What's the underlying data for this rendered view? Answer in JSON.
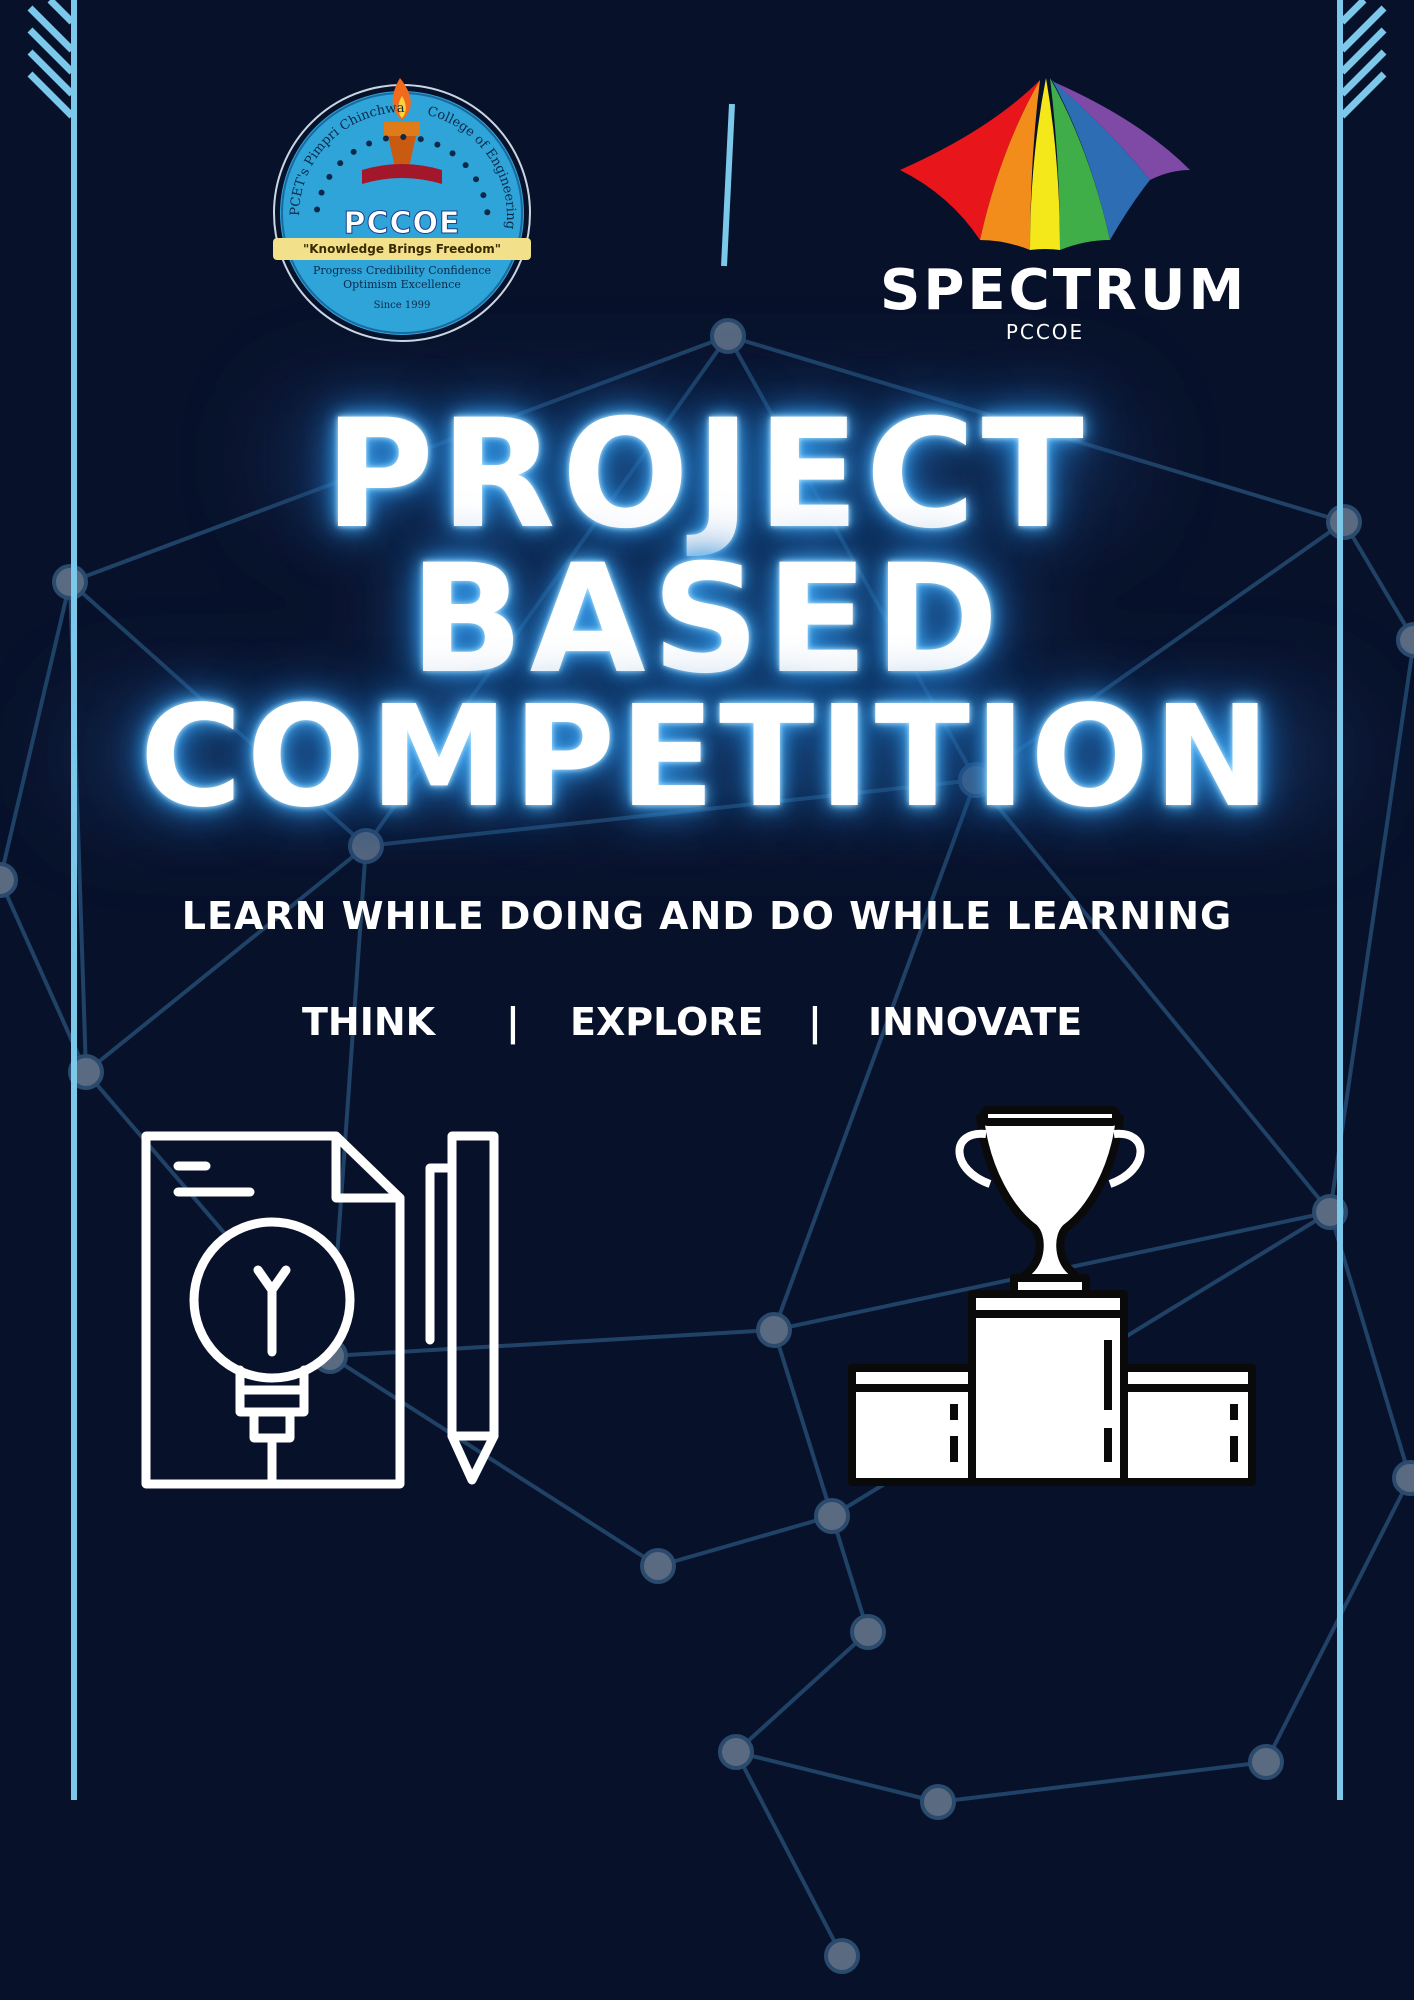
{
  "poster": {
    "title_line_1": "PROJECT",
    "title_line_2": "BASED",
    "title_line_3": "COMPETITION",
    "tagline": "LEARN WHILE DOING AND DO WHILE LEARNING",
    "pillars": {
      "think": "THINK",
      "explore": "EXPLORE",
      "innovate": "INNOVATE",
      "separator": "|"
    }
  },
  "logos": {
    "pccoe": {
      "name": "PCCOE",
      "ring_text_left": "PCET's Pimpri Chinchwad",
      "ring_text_right": "College of Engineering",
      "motto": "\"Knowledge Brings Freedom\"",
      "values_line_1": "Progress Credibility Confidence",
      "values_line_2": "Optimism Excellence",
      "since": "Since 1999"
    },
    "spectrum": {
      "name": "SPECTRUM",
      "sub": "PCCOE"
    }
  },
  "icons": {
    "left": "document-lightbulb-pen-icon",
    "right": "trophy-podium-icon"
  },
  "colors": {
    "background": "#08112a",
    "accent_line": "#7cc8ea",
    "network_line": "#1f4266",
    "network_node": "#5a6a80",
    "glow": "#4fb8ff"
  }
}
